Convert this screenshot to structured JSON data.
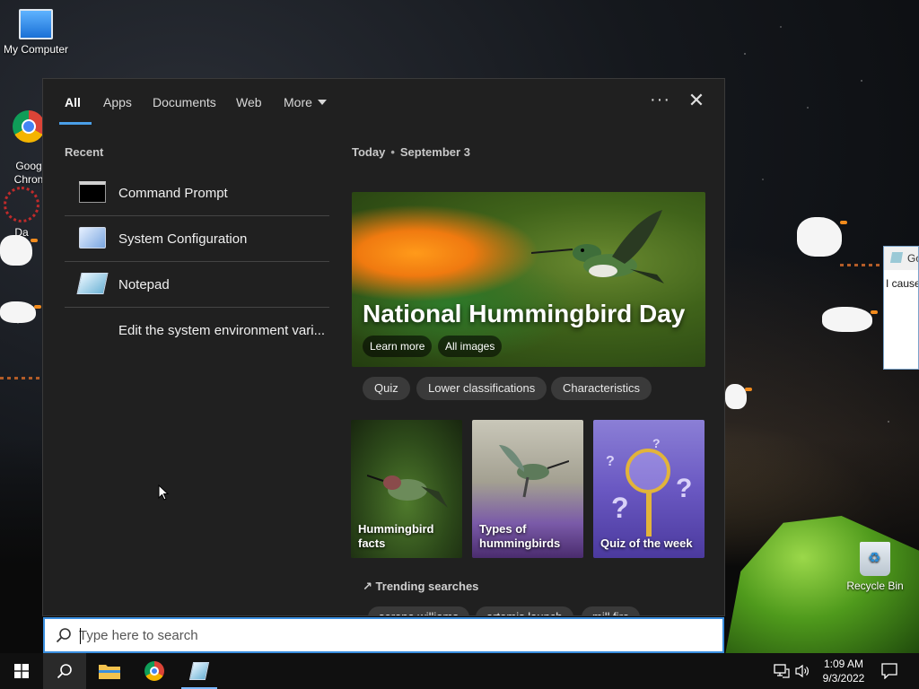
{
  "desktop": {
    "icons": [
      {
        "label": "My Computer"
      },
      {
        "label": "Goog\nChron"
      },
      {
        "label": "Da"
      },
      {
        "label": "Recycle Bin"
      }
    ],
    "side_window": {
      "title": "Go",
      "body_text": "I cause"
    }
  },
  "search_panel": {
    "tabs": [
      {
        "label": "All"
      },
      {
        "label": "Apps"
      },
      {
        "label": "Documents"
      },
      {
        "label": "Web"
      },
      {
        "label": "More"
      }
    ],
    "more_options": "···",
    "close": "✕",
    "recent": {
      "heading": "Recent",
      "items": [
        {
          "label": "Command Prompt",
          "icon": "command-prompt-icon"
        },
        {
          "label": "System Configuration",
          "icon": "system-configuration-icon"
        },
        {
          "label": "Notepad",
          "icon": "notepad-icon"
        },
        {
          "label": "Edit the system environment vari...",
          "icon": ""
        }
      ]
    },
    "today": {
      "label": "Today",
      "separator": "•",
      "date": "September 3"
    },
    "hero": {
      "title": "National Hummingbird Day",
      "buttons": [
        {
          "label": "Learn more"
        },
        {
          "label": "All images"
        }
      ]
    },
    "chips": [
      {
        "label": "Quiz"
      },
      {
        "label": "Lower classifications"
      },
      {
        "label": "Characteristics"
      }
    ],
    "cards": [
      {
        "label": "Hummingbird facts"
      },
      {
        "label": "Types of hummingbirds"
      },
      {
        "label": "Quiz of the week"
      }
    ],
    "trending": {
      "heading": "Trending searches",
      "items": [
        {
          "label": "serena williams"
        },
        {
          "label": "artemis launch"
        },
        {
          "label": "mill fire"
        }
      ]
    }
  },
  "searchbox": {
    "placeholder": "Type here to search",
    "value": ""
  },
  "taskbar": {
    "clock": {
      "time": "1:09 AM",
      "date": "9/3/2022"
    }
  },
  "colors": {
    "accent": "#3a8fe0",
    "panel_bg": "#202020",
    "taskbar_bg": "#101010"
  }
}
